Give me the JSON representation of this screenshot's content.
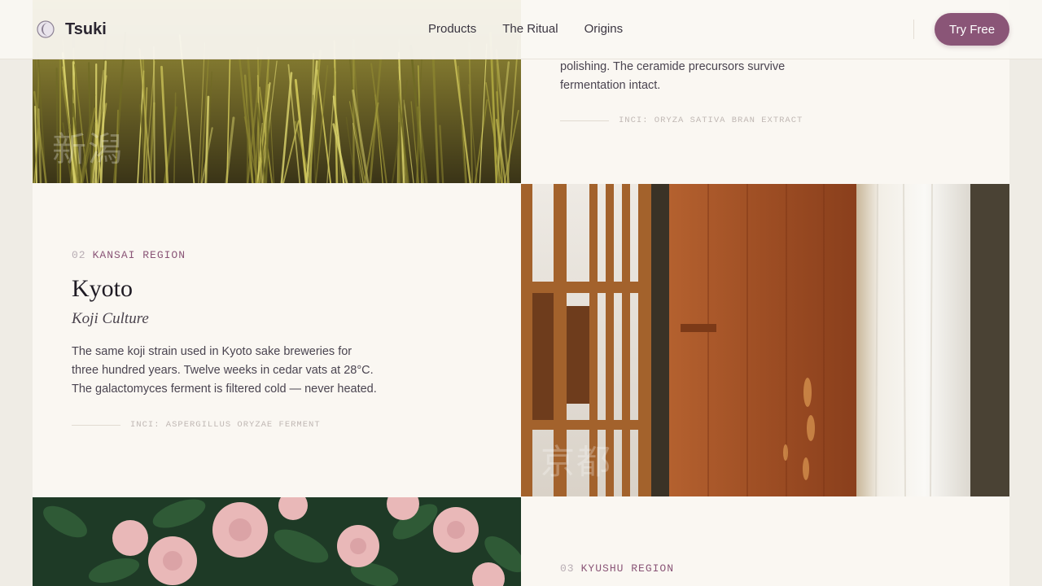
{
  "nav": {
    "brand": "Tsuki",
    "links": [
      "Products",
      "The Ritual",
      "Origins"
    ],
    "cta_label": "Try Free"
  },
  "colors": {
    "accent": "#8a5577",
    "background": "#faf7f2"
  },
  "sections": {
    "niigata": {
      "image_kanji": "新潟",
      "image_description_icon": "rice-field-photo",
      "body_tail": "polishing. The ceramide precursors survive fermentation intact.",
      "inci": "INCI: ORYZA SATIVA BRAN EXTRACT"
    },
    "kyoto": {
      "number": "02",
      "region": "KANSAI REGION",
      "title": "Kyoto",
      "subtitle": "Koji Culture",
      "body": "The same koji strain used in Kyoto sake breweries for three hundred years. Twelve weeks in cedar vats at 28°C. The galactomyces ferment is filtered cold — never heated.",
      "inci": "INCI: ASPERGILLUS ORYZAE FERMENT",
      "image_kanji": "京都"
    },
    "kyushu": {
      "number": "03",
      "region": "KYUSHU REGION"
    }
  }
}
